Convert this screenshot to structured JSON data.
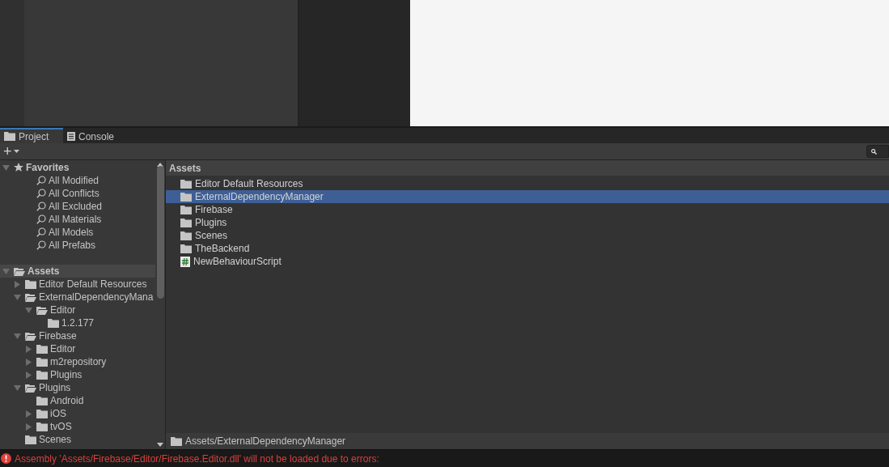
{
  "tabs": [
    {
      "label": "Project",
      "kind": "folder",
      "selected": true
    },
    {
      "label": "Console",
      "kind": "console",
      "selected": false
    }
  ],
  "toolbar": {
    "add_label": "+"
  },
  "tree": [
    {
      "label": "Favorites",
      "kind": "favorites",
      "expanded": true,
      "children": [
        {
          "label": "All Modified",
          "kind": "search"
        },
        {
          "label": "All Conflicts",
          "kind": "search"
        },
        {
          "label": "All Excluded",
          "kind": "search"
        },
        {
          "label": "All Materials",
          "kind": "search"
        },
        {
          "label": "All Models",
          "kind": "search"
        },
        {
          "label": "All Prefabs",
          "kind": "search"
        }
      ]
    },
    {
      "label": "Assets",
      "kind": "root",
      "expanded": true,
      "children": [
        {
          "label": "Editor Default Resources",
          "kind": "folder",
          "expanded": false
        },
        {
          "label": "ExternalDependencyMana",
          "kind": "folder",
          "expanded": true,
          "children": [
            {
              "label": "Editor",
              "kind": "folder",
              "expanded": true,
              "children": [
                {
                  "label": "1.2.177",
                  "kind": "folder"
                }
              ]
            }
          ]
        },
        {
          "label": "Firebase",
          "kind": "folder",
          "expanded": true,
          "children": [
            {
              "label": "Editor",
              "kind": "folder",
              "expanded": false
            },
            {
              "label": "m2repository",
              "kind": "folder",
              "expanded": false
            },
            {
              "label": "Plugins",
              "kind": "folder",
              "expanded": false
            }
          ]
        },
        {
          "label": "Plugins",
          "kind": "folder",
          "expanded": true,
          "children": [
            {
              "label": "Android",
              "kind": "folder"
            },
            {
              "label": "iOS",
              "kind": "folder",
              "expanded": false
            },
            {
              "label": "tvOS",
              "kind": "folder",
              "expanded": false
            }
          ]
        },
        {
          "label": "Scenes",
          "kind": "folder"
        }
      ]
    }
  ],
  "content": {
    "title": "Assets",
    "items": [
      {
        "label": "Editor Default Resources",
        "kind": "folder",
        "selected": false
      },
      {
        "label": "ExternalDependencyManager",
        "kind": "folder",
        "selected": true
      },
      {
        "label": "Firebase",
        "kind": "folder",
        "selected": false
      },
      {
        "label": "Plugins",
        "kind": "folder",
        "selected": false
      },
      {
        "label": "Scenes",
        "kind": "folder",
        "selected": false
      },
      {
        "label": "TheBackend",
        "kind": "folder",
        "selected": false
      },
      {
        "label": "NewBehaviourScript",
        "kind": "script",
        "selected": false
      }
    ],
    "path": "Assets/ExternalDependencyManager"
  },
  "status_bar": {
    "message": "Assembly 'Assets/Firebase/Editor/Firebase.Editor.dll' will not be loaded due to errors:",
    "error": true
  }
}
